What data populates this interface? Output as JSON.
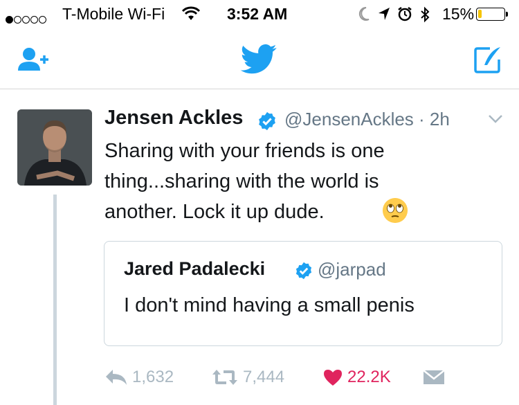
{
  "status_bar": {
    "signal_dots_filled": 1,
    "signal_dots_total": 5,
    "carrier": "T-Mobile Wi-Fi",
    "time": "3:52 AM",
    "battery_percent": "15%",
    "battery_level": 0.15
  },
  "nav": {
    "icons": [
      "add-user-icon",
      "twitter-bird-icon",
      "compose-icon"
    ],
    "accent_color": "#1da1f2"
  },
  "tweet": {
    "author_name": "Jensen Ackles",
    "handle_time": "@JensenAckles · 2h",
    "text_lines": [
      "Sharing with your friends is one",
      "thing...sharing with the world is",
      "another.  Lock it up dude."
    ],
    "emoji": "face-with-rolling-eyes",
    "quoted": {
      "author_name": "Jared Padalecki",
      "handle": "@jarpad",
      "text": "I don't mind having a small penis"
    },
    "actions": {
      "replies": "1,632",
      "retweets": "7,444",
      "likes": "22.2K"
    },
    "liked": true
  }
}
